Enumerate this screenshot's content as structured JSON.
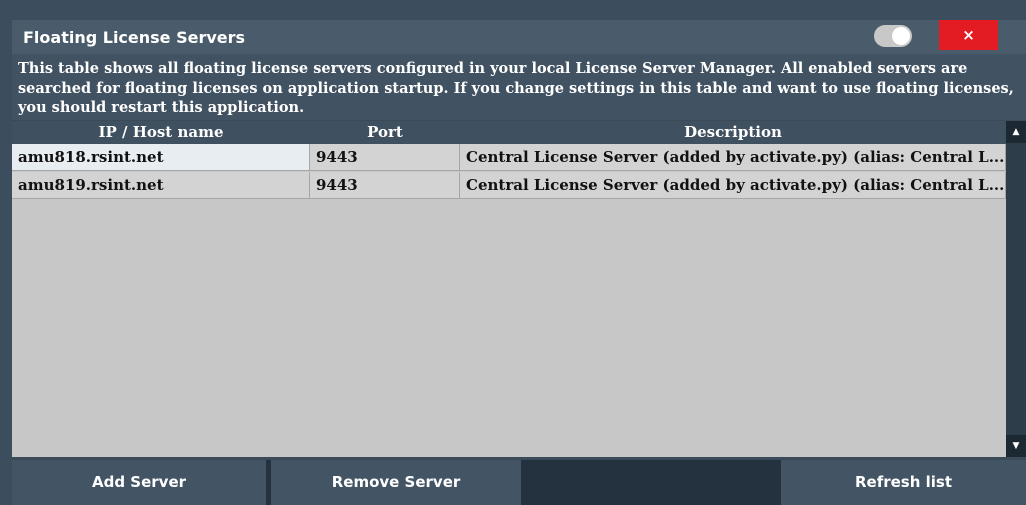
{
  "dialog": {
    "title": "Floating License Servers",
    "close_label": "×",
    "info_text": "This table shows all floating license servers configured in your local License Server Manager. All enabled servers are searched for floating licenses on application startup. If you change settings in this table and want to use floating licenses, you should restart this application."
  },
  "table": {
    "columns": [
      "IP / Host name",
      "Port",
      "Description"
    ],
    "rows": [
      [
        "amu818.rsint.net",
        "9443",
        "Central License Server (added by activate.py) (alias: Central L..."
      ],
      [
        "amu819.rsint.net",
        "9443",
        "Central License Server (added by activate.py) (alias: Central L..."
      ]
    ]
  },
  "scrollbar": {
    "up_icon": "▲",
    "down_icon": "▼"
  },
  "buttons": {
    "add": "Add Server",
    "remove": "Remove Server",
    "refresh": "Refresh list"
  },
  "colors": {
    "title_bar": "#4a5c6b",
    "close_button": "#e31b23",
    "table_background": "#c7c7c7",
    "selected_cell": "#e8edf2",
    "button": "#435565"
  }
}
